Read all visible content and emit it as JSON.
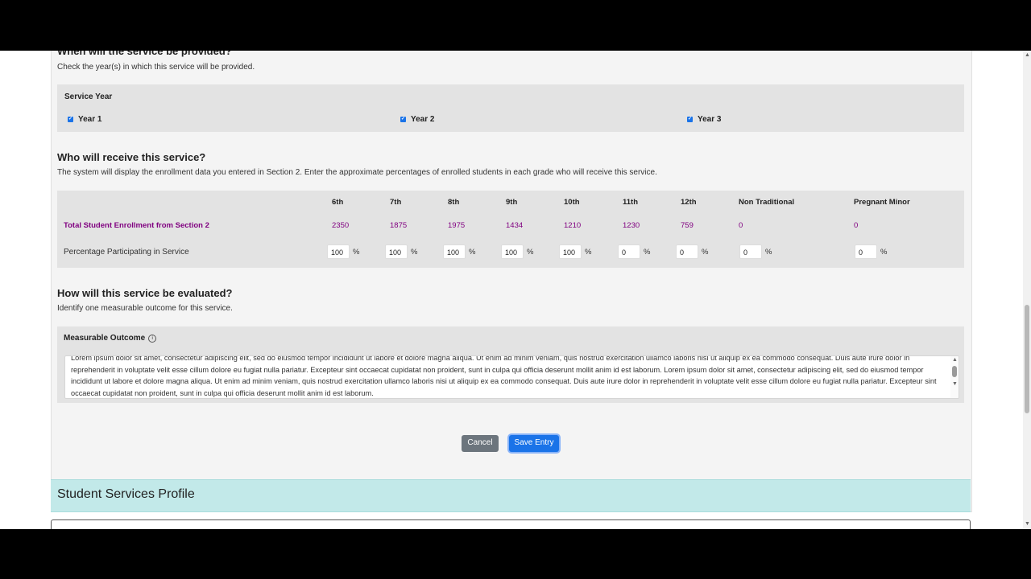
{
  "when": {
    "heading": "When will the service be provided?",
    "description": "Check the year(s) in which this service will be provided.",
    "group_label": "Service Year",
    "years": [
      {
        "label": "Year 1",
        "checked": true
      },
      {
        "label": "Year 2",
        "checked": true
      },
      {
        "label": "Year 3",
        "checked": true
      }
    ]
  },
  "who": {
    "heading": "Who will receive this service?",
    "description": "The system will display the enrollment data you entered in Section 2. Enter the approximate percentages of enrolled students in each grade who will receive this service.",
    "columns": [
      "6th",
      "7th",
      "8th",
      "9th",
      "10th",
      "11th",
      "12th",
      "Non Traditional",
      "Pregnant Minor"
    ],
    "enrollment_label": "Total Student Enrollment from Section 2",
    "enrollment": [
      "2350",
      "1875",
      "1975",
      "1434",
      "1210",
      "1230",
      "759",
      "0",
      "0"
    ],
    "percentage_label": "Percentage Participating in Service",
    "percentages": [
      "100",
      "100",
      "100",
      "100",
      "100",
      "0",
      "0",
      "0",
      "0"
    ],
    "percent_sign": "%"
  },
  "how": {
    "heading": "How will this service be evaluated?",
    "description": "Identify one measurable outcome for this service.",
    "outcome_label": "Measurable Outcome",
    "info_icon": "info-icon",
    "outcome_text": "Lorem ipsum dolor sit amet, consectetur adipiscing elit, sed do eiusmod tempor incididunt ut labore et dolore magna aliqua. Ut enim ad minim veniam, quis nostrud exercitation ullamco laboris nisi ut aliquip ex ea commodo consequat. Duis aute irure dolor in reprehenderit in voluptate velit esse cillum dolore eu fugiat nulla pariatur. Excepteur sint occaecat cupidatat non proident, sunt in culpa qui officia deserunt mollit anim id est laborum. Lorem ipsum dolor sit amet, consectetur adipiscing elit, sed do eiusmod tempor incididunt ut labore et dolore magna aliqua. Ut enim ad minim veniam, quis nostrud exercitation ullamco laboris nisi ut aliquip ex ea commodo consequat. Duis aute irure dolor in reprehenderit in voluptate velit esse cillum dolore eu fugiat nulla pariatur. Excepteur sint occaecat cupidatat non proident, sunt in culpa qui officia deserunt mollit anim id est laborum."
  },
  "actions": {
    "cancel_label": "Cancel",
    "save_label": "Save Entry"
  },
  "profile": {
    "title": "Student Services Profile"
  },
  "colors": {
    "accent": "#1a73e8",
    "enrollment_text": "#800080",
    "cancel_bg": "#6c757d",
    "profile_bg": "#c2e9e9"
  }
}
